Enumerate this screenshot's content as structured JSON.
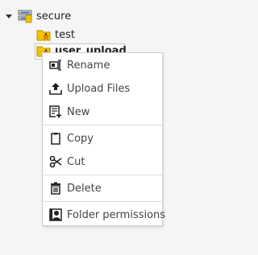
{
  "tree": {
    "root": {
      "label": "secure"
    },
    "children": [
      {
        "label": "test"
      },
      {
        "label": "user_upload"
      }
    ]
  },
  "context_menu": {
    "items": [
      {
        "label": "Rename",
        "icon": "rename-icon"
      },
      {
        "label": "Upload Files",
        "icon": "upload-icon"
      },
      {
        "label": "New",
        "icon": "new-file-icon"
      },
      {
        "label": "Copy",
        "icon": "copy-icon"
      },
      {
        "label": "Cut",
        "icon": "scissors-icon"
      },
      {
        "label": "Delete",
        "icon": "trash-icon"
      },
      {
        "label": "Folder permissions",
        "icon": "folder-permissions-icon"
      }
    ]
  },
  "colors": {
    "folder_yellow": "#f2c400",
    "folder_orange": "#e6a100",
    "storage_blue": "#2b73c9",
    "menu_border": "#cfcfcf"
  }
}
